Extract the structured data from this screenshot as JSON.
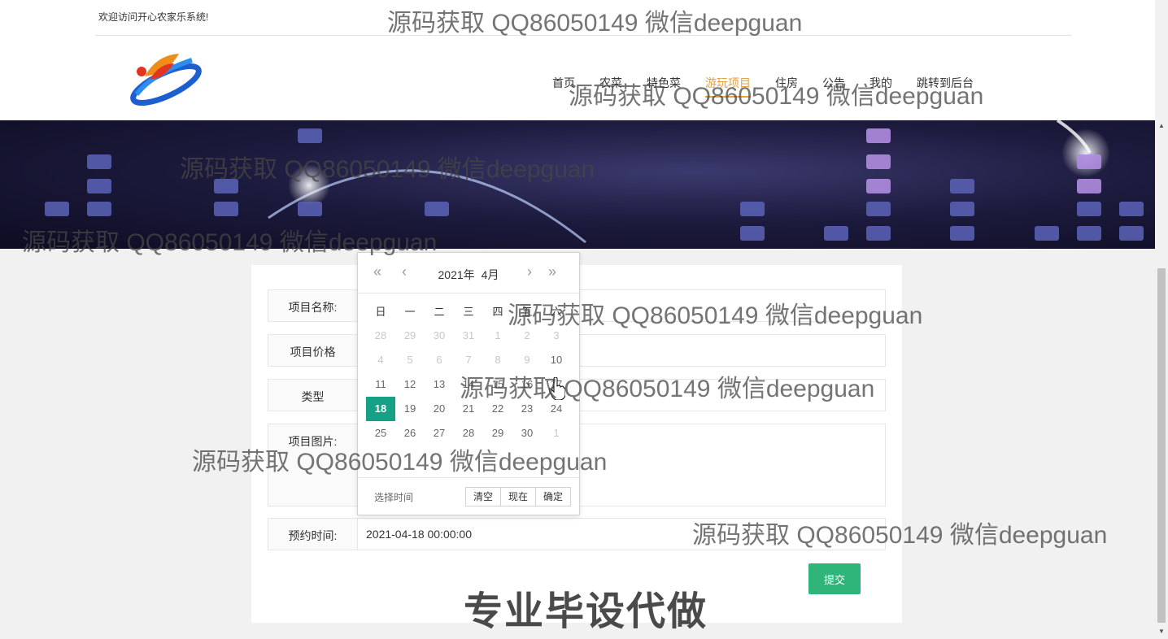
{
  "topbar": {
    "welcome": "欢迎访问开心农家乐系统!"
  },
  "nav": {
    "items": [
      "首页",
      "农菜",
      "特色菜",
      "游玩项目",
      "住房",
      "公告",
      "我的",
      "跳转到后台"
    ],
    "active_index": 3,
    "active_color": "#e6a23c"
  },
  "form": {
    "fields": [
      {
        "label": "项目名称:",
        "value": ""
      },
      {
        "label": "项目价格",
        "value": ""
      },
      {
        "label": "类型",
        "value": ""
      },
      {
        "label": "项目图片:",
        "value": ""
      },
      {
        "label": "预约时间:",
        "value": "2021-04-18 00:00:00"
      }
    ],
    "submit_label": "提交",
    "submit_color": "#2fb47a"
  },
  "datepicker": {
    "year_label": "2021年",
    "month_label": "4月",
    "prev_year_icon": "double-chevron-left-icon",
    "prev_month_icon": "chevron-left-icon",
    "next_month_icon": "chevron-right-icon",
    "next_year_icon": "double-chevron-right-icon",
    "weekdays": [
      "日",
      "一",
      "二",
      "三",
      "四",
      "五",
      "六"
    ],
    "weeks": [
      [
        "28",
        "29",
        "30",
        "31",
        "1",
        "2",
        "3"
      ],
      [
        "4",
        "5",
        "6",
        "7",
        "8",
        "9",
        "10"
      ],
      [
        "11",
        "12",
        "13",
        "14",
        "15",
        "16",
        "17"
      ],
      [
        "18",
        "19",
        "20",
        "21",
        "22",
        "23",
        "24"
      ],
      [
        "25",
        "26",
        "27",
        "28",
        "29",
        "30",
        "1"
      ]
    ],
    "selected": "18",
    "selected_color": "#16a085",
    "choose_time": "选择时间",
    "buttons": [
      "清空",
      "现在",
      "确定"
    ]
  },
  "watermarks": {
    "text": "源码获取 QQ86050149 微信deepguan",
    "big": "专业毕设代做"
  }
}
